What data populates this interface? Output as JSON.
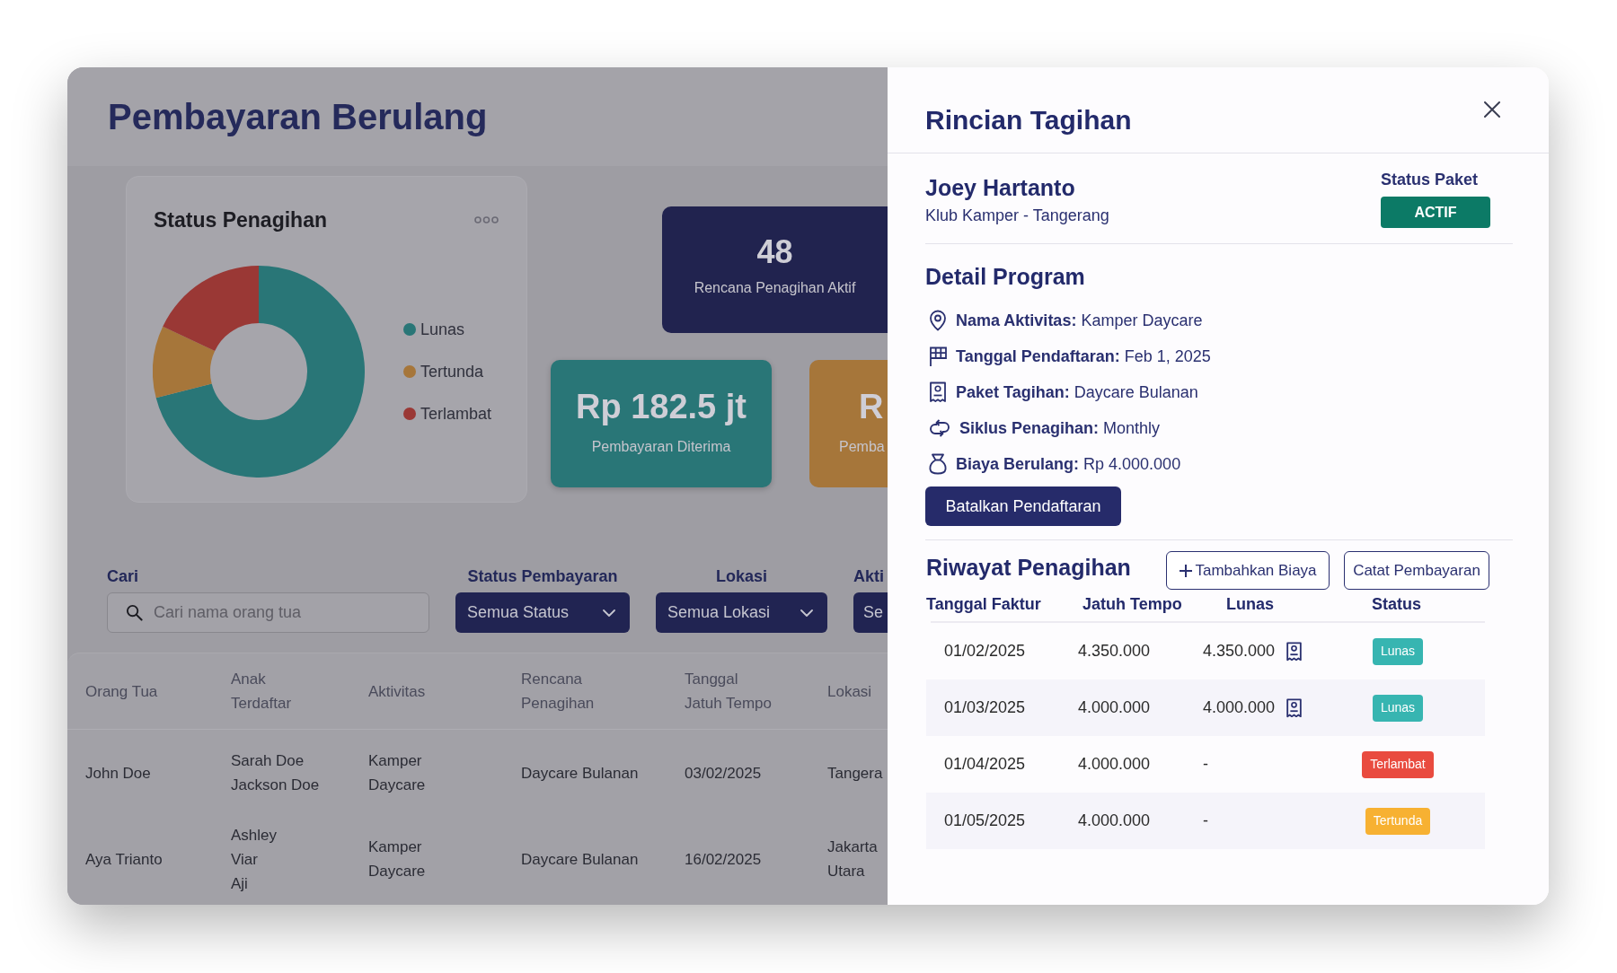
{
  "page": {
    "title": "Pembayaran Berulang"
  },
  "status_card": {
    "title": "Status Penagihan",
    "chart_data": {
      "type": "donut",
      "categories": [
        "Lunas",
        "Tertunda",
        "Terlambat"
      ],
      "values": [
        71,
        11,
        18
      ],
      "colors": [
        "#297677",
        "#a6763a",
        "#9a3835"
      ]
    }
  },
  "stat_cards": [
    {
      "value": "48",
      "label": "Rencana Penagihan Aktif",
      "color": "#21234f"
    },
    {
      "value": "Rp 182.5 jt",
      "label": "Pembayaran Diterima",
      "color": "#297677"
    },
    {
      "value": "R",
      "label": "Pemba",
      "color": "#a6763a"
    }
  ],
  "filters": {
    "search": {
      "label": "Cari",
      "placeholder": "Cari nama orang tua"
    },
    "dropdowns": [
      {
        "label": "Status Pembayaran",
        "value": "Semua Status"
      },
      {
        "label": "Lokasi",
        "value": "Semua Lokasi"
      },
      {
        "label": "Akti",
        "value": "Se"
      }
    ]
  },
  "table": {
    "columns": [
      "Orang Tua",
      "Anak Terdaftar",
      "Aktivitas",
      "Rencana Penagihan",
      "Tanggal Jatuh Tempo",
      "Lokasi"
    ],
    "rows": [
      {
        "parent": "John Doe",
        "children": [
          "Sarah Doe",
          "Jackson Doe"
        ],
        "activity": "Kamper Daycare",
        "plan": "Daycare Bulanan",
        "due_date": "03/02/2025",
        "location": "Tangera"
      },
      {
        "parent": "Aya Trianto",
        "children": [
          "Ashley",
          "Viar",
          "Aji"
        ],
        "activity": "Kamper Daycare",
        "plan": "Daycare Bulanan",
        "due_date": "16/02/2025",
        "location": "Jakarta Utara"
      }
    ]
  },
  "drawer": {
    "title": "Rincian Tagihan",
    "customer": {
      "name": "Joey Hartanto",
      "subtitle": "Klub Kamper - Tangerang"
    },
    "package_status": {
      "label": "Status Paket",
      "badge": "ACTIF"
    },
    "program": {
      "title": "Detail Program",
      "items": [
        {
          "kind": "location",
          "text": "**Nama Aktivitas:** Kamper Daycare"
        },
        {
          "kind": "flag",
          "text": "**Tanggal Pendaftaran:** Feb 1, 2025"
        },
        {
          "kind": "receipt",
          "text": "**Paket Tagihan:** Daycare Bulanan"
        },
        {
          "kind": "repeat",
          "text": "**Siklus Penagihan:** Monthly"
        },
        {
          "kind": "bag",
          "text": "**Biaya Berulang:** Rp 4.000.000"
        }
      ]
    },
    "cancel_button": "Batalkan Pendaftaran",
    "history": {
      "title": "Riwayat Penagihan",
      "actions": [
        {
          "kind": "add",
          "label": "Tambahkan Biaya"
        },
        {
          "kind": "plain",
          "label": "Catat Pembayaran"
        }
      ],
      "columns": [
        "Tanggal Faktur",
        "Jatuh Tempo",
        "Lunas",
        "Status"
      ],
      "rows": [
        {
          "invoice_date": "01/02/2025",
          "due": "4.350.000",
          "paid": "4.350.000",
          "receipt": true,
          "status": {
            "label": "Lunas",
            "color": "#37b5b1"
          }
        },
        {
          "invoice_date": "01/03/2025",
          "due": "4.000.000",
          "paid": "4.000.000",
          "receipt": true,
          "status": {
            "label": "Lunas",
            "color": "#37b5b1"
          }
        },
        {
          "invoice_date": "01/04/2025",
          "due": "4.000.000",
          "paid": "-",
          "receipt": false,
          "status": {
            "label": "Terlambat",
            "color": "#e94b3f"
          }
        },
        {
          "invoice_date": "01/05/2025",
          "due": "4.000.000",
          "paid": "-",
          "receipt": false,
          "status": {
            "label": "Tertunda",
            "color": "#f7b132"
          }
        }
      ]
    }
  }
}
